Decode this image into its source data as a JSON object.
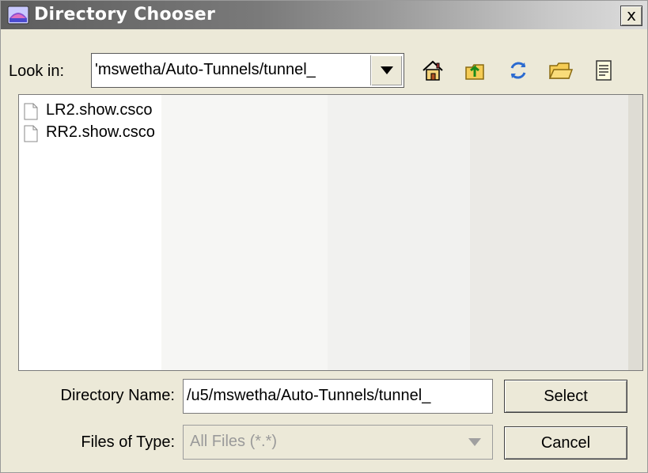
{
  "window": {
    "title": "Directory Chooser",
    "close_label": "x"
  },
  "lookin": {
    "label": "Look in:",
    "value": "'mswetha/Auto-Tunnels/tunnel_"
  },
  "toolbar": {
    "icons": [
      "home-icon",
      "up-folder-icon",
      "refresh-icon",
      "new-folder-icon",
      "details-view-icon"
    ]
  },
  "files": [
    {
      "name": "LR2.show.csco"
    },
    {
      "name": "RR2.show.csco"
    }
  ],
  "directory_name": {
    "label": "Directory Name:",
    "value": "/u5/mswetha/Auto-Tunnels/tunnel_"
  },
  "files_of_type": {
    "label": "Files of Type:",
    "value": "All Files (*.*)"
  },
  "buttons": {
    "select": "Select",
    "cancel": "Cancel"
  },
  "colors": {
    "dialog_bg": "#ece9d8",
    "title_text": "#ffffff",
    "disabled_text": "#9a9a9a"
  }
}
